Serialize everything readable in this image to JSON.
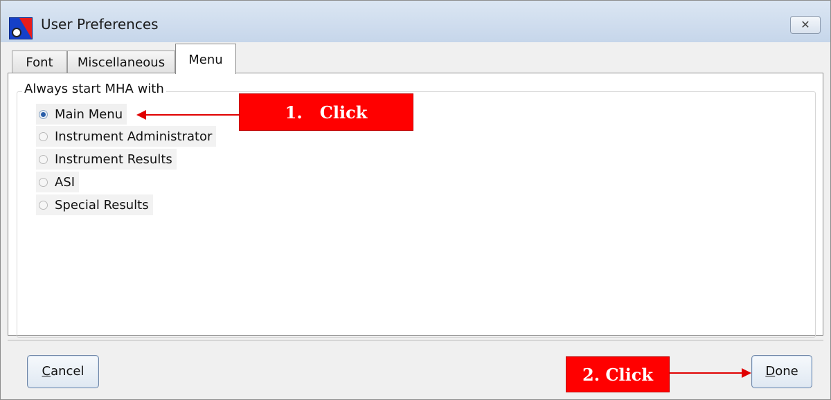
{
  "window": {
    "title": "User Preferences",
    "close_label": "✕"
  },
  "tabs": [
    {
      "label": "Font",
      "active": false
    },
    {
      "label": "Miscellaneous",
      "active": false
    },
    {
      "label": "Menu",
      "active": true
    }
  ],
  "menu_group": {
    "legend": "Always start MHA with",
    "options": [
      {
        "label": "Main Menu",
        "selected": true
      },
      {
        "label": "Instrument Administrator",
        "selected": false
      },
      {
        "label": "Instrument Results",
        "selected": false
      },
      {
        "label": "ASI",
        "selected": false
      },
      {
        "label": "Special Results",
        "selected": false
      }
    ]
  },
  "buttons": {
    "cancel_first": "C",
    "cancel_rest": "ancel",
    "done_first": "D",
    "done_rest": "one"
  },
  "annotations": {
    "step1": "1.   Click",
    "step2": "2. Click"
  },
  "colors": {
    "annotation": "#ff0000",
    "title_bar": "#c6d6ea"
  }
}
